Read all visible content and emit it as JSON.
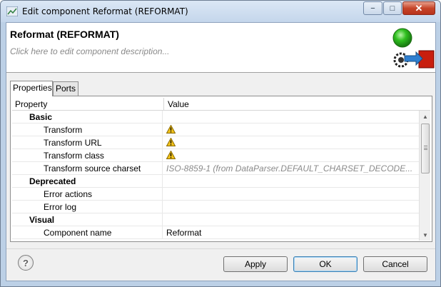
{
  "window": {
    "title": "Edit component Reformat (REFORMAT)",
    "minimize_glyph": "−",
    "maximize_glyph": "□",
    "close_glyph": "✕"
  },
  "header": {
    "component_title": "Reformat (REFORMAT)",
    "description_placeholder": "Click here to edit component description..."
  },
  "tabs": [
    {
      "label": "Properties"
    },
    {
      "label": "Ports"
    }
  ],
  "grid": {
    "columns": {
      "property": "Property",
      "value": "Value"
    },
    "rows": [
      {
        "kind": "category",
        "property": "Basic",
        "value": ""
      },
      {
        "kind": "item",
        "property": "Transform",
        "value": "",
        "icon": "warning-icon"
      },
      {
        "kind": "item",
        "property": "Transform URL",
        "value": "",
        "icon": "warning-icon"
      },
      {
        "kind": "item",
        "property": "Transform class",
        "value": "",
        "icon": "warning-icon"
      },
      {
        "kind": "item",
        "property": "Transform source charset",
        "value": "ISO-8859-1 (from DataParser.DEFAULT_CHARSET_DECODE...",
        "italic": true
      },
      {
        "kind": "category",
        "property": "Deprecated",
        "value": ""
      },
      {
        "kind": "item",
        "property": "Error actions",
        "value": ""
      },
      {
        "kind": "item",
        "property": "Error log",
        "value": ""
      },
      {
        "kind": "category",
        "property": "Visual",
        "value": ""
      },
      {
        "kind": "item",
        "property": "Component name",
        "value": "Reformat"
      }
    ]
  },
  "buttons": {
    "help": "?",
    "apply": "Apply",
    "ok": "OK",
    "cancel": "Cancel"
  },
  "colors": {
    "status_green": "#2fbf1f",
    "status_red": "#c81e0e",
    "arrow_blue": "#2f7fd0",
    "warning_yellow": "#f2c21a"
  }
}
